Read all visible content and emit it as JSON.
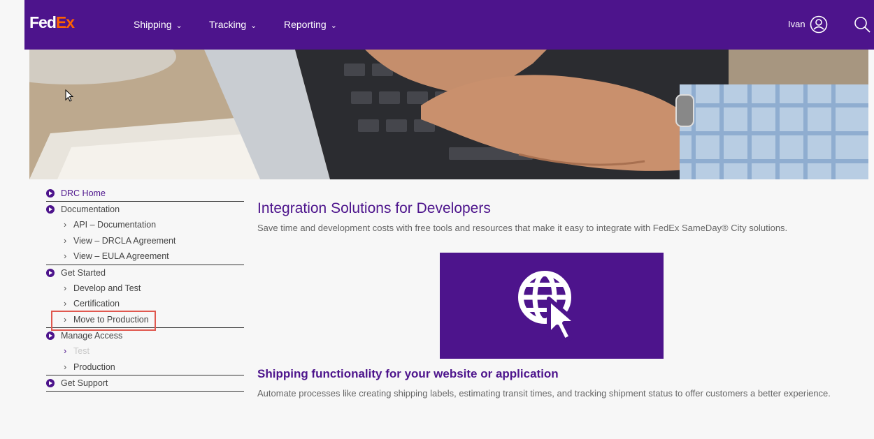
{
  "header": {
    "logo_fed": "Fed",
    "logo_ex": "Ex",
    "nav": [
      {
        "label": "Shipping"
      },
      {
        "label": "Tracking"
      },
      {
        "label": "Reporting"
      }
    ],
    "user_name": "Ivan"
  },
  "sidebar": {
    "sections": [
      {
        "label": "DRC Home",
        "items": []
      },
      {
        "label": "Documentation",
        "items": [
          "API – Documentation",
          "View – DRCLA Agreement",
          "View – EULA Agreement"
        ]
      },
      {
        "label": "Get Started",
        "items": [
          "Develop and Test",
          "Certification",
          "Move to Production"
        ]
      },
      {
        "label": "Manage Access",
        "items": [
          "Test",
          "Production"
        ]
      },
      {
        "label": "Get Support",
        "items": []
      }
    ]
  },
  "main": {
    "title": "Integration Solutions for Developers",
    "intro": "Save time and development costs with free tools and resources that make it easy to integrate with FedEx SameDay® City solutions.",
    "subtitle": "Shipping functionality for your website or application",
    "body": "Automate processes like creating shipping labels, estimating transit times, and tracking shipment status to offer customers a better experience."
  },
  "colors": {
    "brand_purple": "#4d148c",
    "brand_orange": "#ff6200",
    "highlight_red": "#e0584f"
  }
}
